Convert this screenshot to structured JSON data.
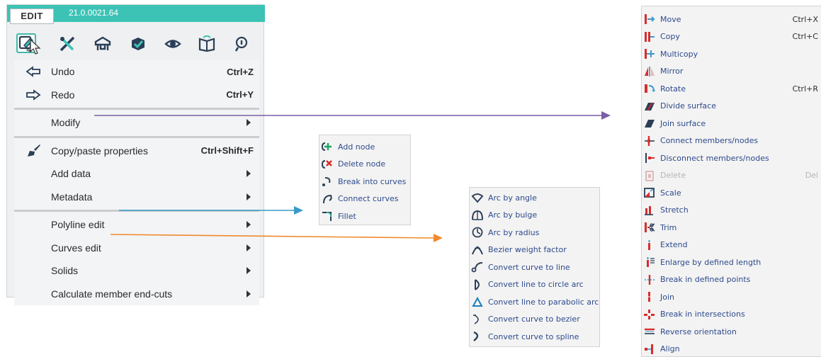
{
  "app": {
    "tab_label": "EDIT",
    "version": "21.0.0021.64",
    "toolbar": [
      "edit-icon",
      "tools-icon",
      "structure-icon",
      "check-icon",
      "eye-icon",
      "book-icon",
      "info-icon"
    ]
  },
  "main_menu": {
    "items": [
      {
        "label": "Undo",
        "shortcut": "Ctrl+Z",
        "icon": "undo-icon"
      },
      {
        "label": "Redo",
        "shortcut": "Ctrl+Y",
        "icon": "redo-icon"
      },
      {
        "label": "Modify",
        "submenu": true
      },
      {
        "label": "Copy/paste properties",
        "shortcut": "Ctrl+Shift+F",
        "icon": "brush-icon"
      },
      {
        "label": "Add data",
        "submenu": true
      },
      {
        "label": "Metadata",
        "submenu": true
      },
      {
        "label": "Polyline edit",
        "submenu": true
      },
      {
        "label": "Curves edit",
        "submenu": true
      },
      {
        "label": "Solids",
        "submenu": true
      },
      {
        "label": "Calculate member end-cuts",
        "submenu": true
      }
    ]
  },
  "polyline_menu": {
    "items": [
      "Add node",
      "Delete node",
      "Break into curves",
      "Connect curves",
      "Fillet"
    ]
  },
  "curves_menu": {
    "items": [
      "Arc by angle",
      "Arc by bulge",
      "Arc by radius",
      "Bezier weight factor",
      "Convert curve to line",
      "Convert line to circle arc",
      "Convert line to parabolic arc",
      "Convert curve to bezier",
      "Convert curve to spline"
    ]
  },
  "modify_menu": {
    "items": [
      {
        "label": "Move",
        "shortcut": "Ctrl+X"
      },
      {
        "label": "Copy",
        "shortcut": "Ctrl+C"
      },
      {
        "label": "Multicopy"
      },
      {
        "label": "Mirror"
      },
      {
        "label": "Rotate",
        "shortcut": "Ctrl+R"
      },
      {
        "label": "Divide surface"
      },
      {
        "label": "Join surface"
      },
      {
        "label": "Connect members/nodes"
      },
      {
        "label": "Disconnect members/nodes"
      },
      {
        "label": "Delete",
        "shortcut": "Del",
        "disabled": true
      },
      {
        "label": "Scale"
      },
      {
        "label": "Stretch"
      },
      {
        "label": "Trim"
      },
      {
        "label": "Extend"
      },
      {
        "label": "Enlarge by defined length"
      },
      {
        "label": "Break in defined points"
      },
      {
        "label": "Join"
      },
      {
        "label": "Break in intersections"
      },
      {
        "label": "Reverse orientation"
      },
      {
        "label": "Align"
      }
    ]
  },
  "colors": {
    "modify_arrow": "#7a5ea8",
    "polyline_arrow": "#3a9ac9",
    "curves_arrow": "#ef8a2e",
    "accent": "#3cc3b5"
  }
}
